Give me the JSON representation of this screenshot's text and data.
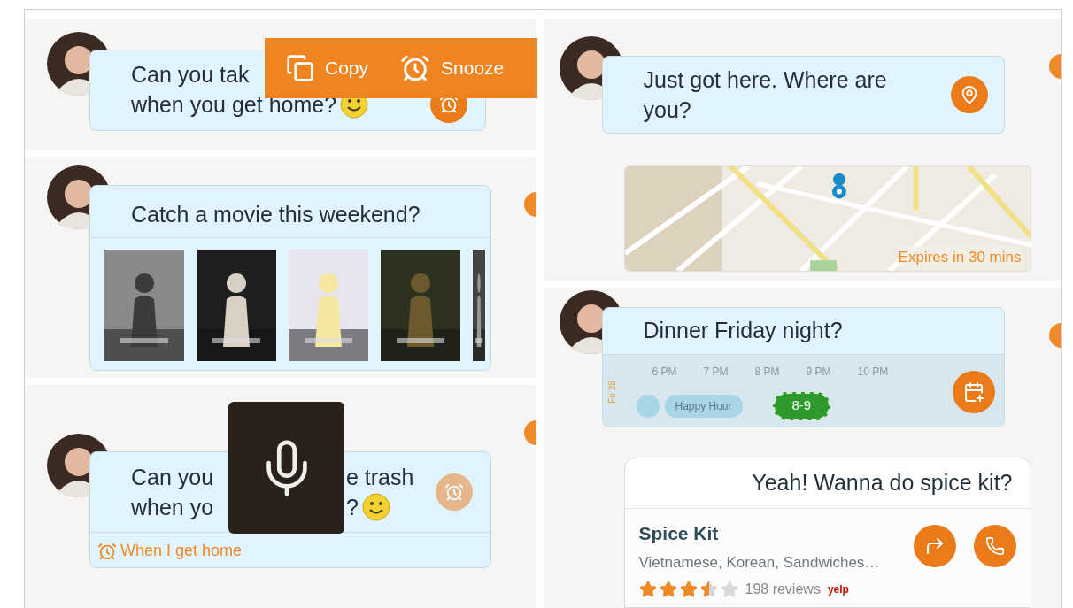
{
  "snooze_message": {
    "lines": [
      "Can you tak",
      "when you get home?"
    ],
    "popup": {
      "actions": [
        {
          "kind": "copy",
          "label": "Copy"
        },
        {
          "kind": "snooze",
          "label": "Snooze"
        }
      ]
    }
  },
  "movie_message": {
    "text": "Catch a movie this weekend?"
  },
  "voice_message": {
    "lines": [
      [
        "Can you",
        "e trash"
      ],
      [
        "when yo",
        "?"
      ]
    ],
    "reminder": "When I get home"
  },
  "location_message": {
    "lines": [
      "Just got here. Where are",
      "you?"
    ],
    "expiry": "Expires in 30 mins"
  },
  "dinner_message": {
    "text": "Dinner Friday night?",
    "day_label": "Fri 28",
    "times": [
      "6 PM",
      "7 PM",
      "8 PM",
      "9 PM",
      "10 PM"
    ],
    "events": [
      {
        "kind": "dot"
      },
      {
        "kind": "busy",
        "label": "Happy Hour"
      },
      {
        "kind": "proposed",
        "label": "8-9"
      }
    ]
  },
  "restaurant_reply": {
    "text": "Yeah! Wanna do spice kit?",
    "name": "Spice Kit",
    "categories": "Vietnamese, Korean, Sandwiches…",
    "stars": 3.5,
    "reviews": "198 reviews",
    "source": "yelp"
  }
}
